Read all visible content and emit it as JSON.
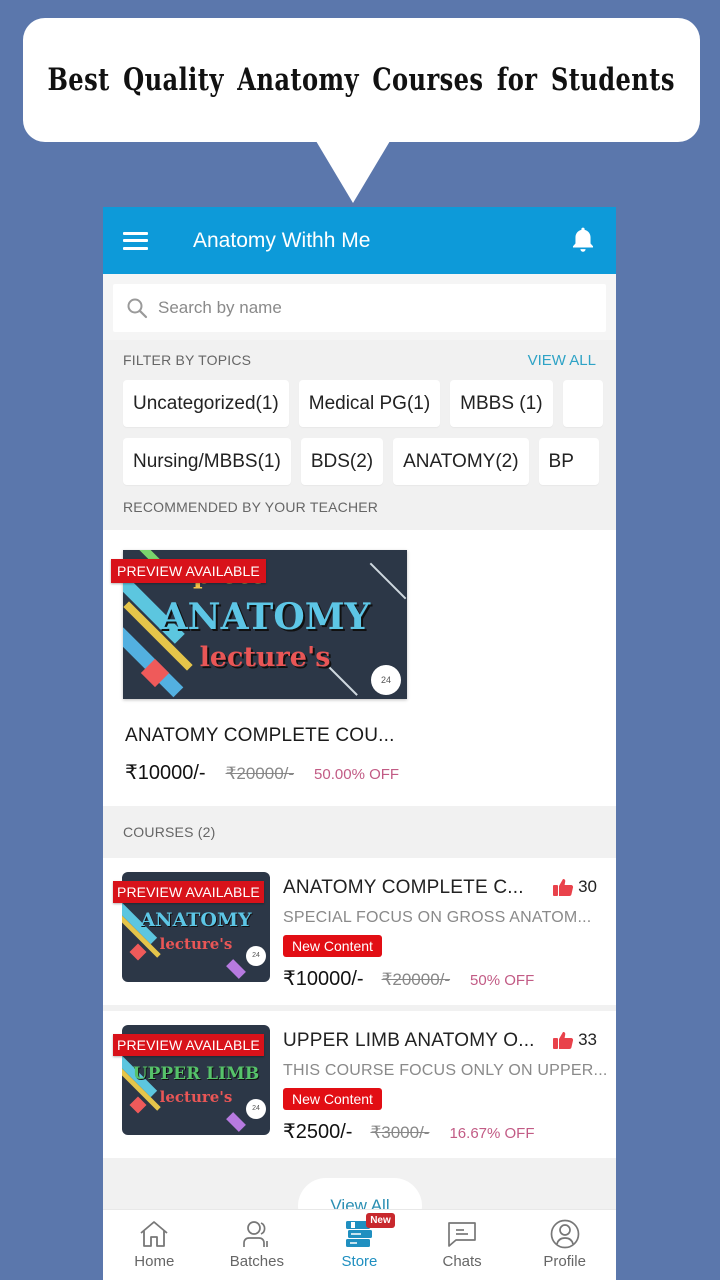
{
  "promo": {
    "headline": "Best Quality Anatomy Courses for Students"
  },
  "colors": {
    "background": "#5b77ac",
    "appbar": "#0d9ad9",
    "accent": "#1f8fc0",
    "badge_red": "#e20e14",
    "discount": "#c25b85"
  },
  "appbar": {
    "title": "Anatomy Withh Me",
    "menu_icon": "hamburger-menu-icon",
    "notification_icon": "bell-icon"
  },
  "search": {
    "placeholder": "Search by name",
    "value": ""
  },
  "filter": {
    "label": "FILTER BY TOPICS",
    "view_all": "VIEW ALL",
    "row1": [
      "Uncategorized(1)",
      "Medical PG(1)",
      "MBBS (1)",
      ""
    ],
    "row2": [
      "Nursing/MBBS(1)",
      "BDS(2)",
      "ANATOMY(2)",
      "BP"
    ]
  },
  "recommended": {
    "label": "RECOMMENDED BY YOUR TEACHER",
    "item": {
      "ribbon": "PREVIEW AVAILABLE",
      "thumb_line1": "plete",
      "thumb_line2": "ANATOMY",
      "thumb_line3": "lecture's",
      "title": "ANATOMY  COMPLETE COU...",
      "price": "₹10000/-",
      "original_price": "₹20000/-",
      "discount": "50.00% OFF"
    }
  },
  "courses": {
    "label": "COURSES (2)",
    "items": [
      {
        "ribbon": "PREVIEW AVAILABLE",
        "thumb_line2": "ANATOMY",
        "thumb_line3": "lecture's",
        "title": "ANATOMY  COMPLETE C...",
        "likes": "30",
        "subtitle": "SPECIAL FOCUS ON  GROSS ANATOM...",
        "badge": "New Content",
        "price": "₹10000/-",
        "original_price": "₹20000/-",
        "discount": "50% OFF"
      },
      {
        "ribbon": "PREVIEW AVAILABLE",
        "thumb_line2": "UPPER  LIMB",
        "thumb_line3": "lecture's",
        "title": "UPPER LIMB ANATOMY  O...",
        "likes": "33",
        "subtitle": "THIS COURSE FOCUS ONLY ON UPPER...",
        "badge": "New Content",
        "price": "₹2500/-",
        "original_price": "₹3000/-",
        "discount": "16.67% OFF"
      }
    ],
    "view_all": "View All"
  },
  "bottom_nav": {
    "items": [
      {
        "label": "Home",
        "icon": "home-icon"
      },
      {
        "label": "Batches",
        "icon": "batches-icon"
      },
      {
        "label": "Store",
        "icon": "store-icon",
        "active": true,
        "tag": "New"
      },
      {
        "label": "Chats",
        "icon": "chat-icon"
      },
      {
        "label": "Profile",
        "icon": "profile-icon"
      }
    ]
  }
}
